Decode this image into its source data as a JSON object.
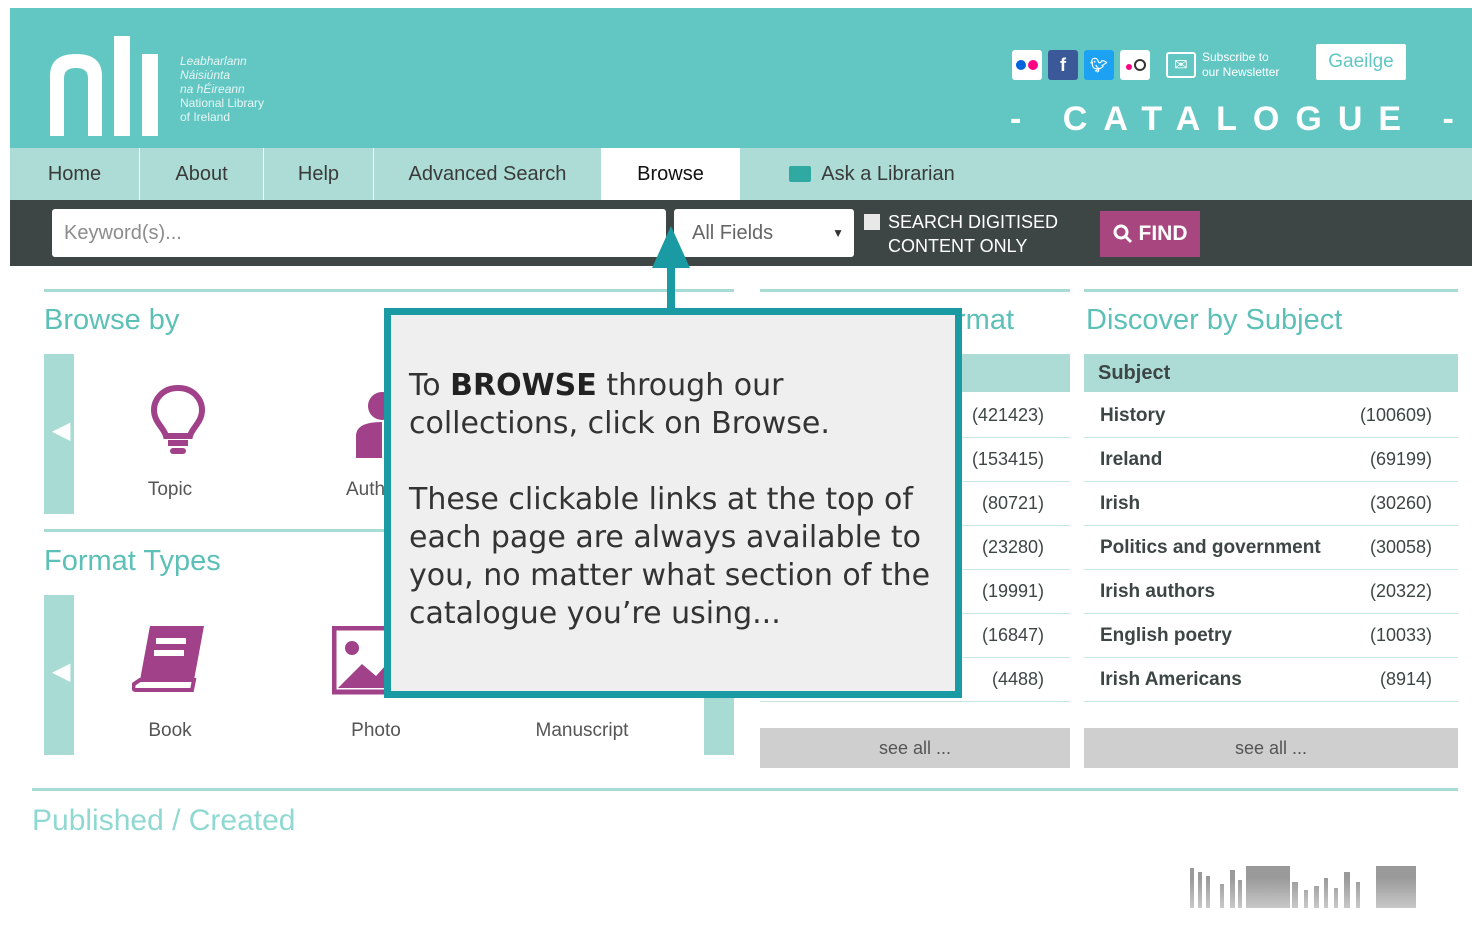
{
  "header": {
    "logo_lines_irish": [
      "Leabharlann",
      "Náisiúnta",
      "na hÉireann"
    ],
    "logo_lines_english": [
      "National Library",
      "of Ireland"
    ],
    "newsletter_line1": "Subscribe to",
    "newsletter_line2": "our Newsletter",
    "gaeilge_label": "Gaeilge",
    "catalogue_title": "- CATALOGUE -"
  },
  "nav": {
    "items": [
      {
        "label": "Home"
      },
      {
        "label": "About"
      },
      {
        "label": "Help"
      },
      {
        "label": "Advanced Search"
      },
      {
        "label": "Browse"
      },
      {
        "label": "Ask a Librarian"
      }
    ],
    "active": "Browse"
  },
  "search": {
    "keyword_placeholder": "Keyword(s)...",
    "field_selected": "All Fields",
    "digitised_line1": "SEARCH DIGITISED",
    "digitised_line2": "CONTENT ONLY",
    "find_label": "FIND"
  },
  "browse_by": {
    "title": "Browse by",
    "tiles": [
      {
        "label": "Topic"
      },
      {
        "label": "Auth"
      }
    ]
  },
  "format_types": {
    "title": "Format Types",
    "tiles": [
      {
        "label": "Book"
      },
      {
        "label": "Photo"
      },
      {
        "label": "Manuscript"
      }
    ]
  },
  "format_panel": {
    "title_partial": "rmat",
    "counts": [
      "(421423)",
      "(153415)",
      "(80721)",
      "(23280)",
      "(19991)",
      "(16847)",
      "(4488)"
    ],
    "see_all": "see all ..."
  },
  "discover": {
    "title": "Discover by Subject",
    "header": "Subject",
    "rows": [
      {
        "name": "History",
        "count": "(100609)"
      },
      {
        "name": "Ireland",
        "count": "(69199)"
      },
      {
        "name": "Irish",
        "count": "(30260)"
      },
      {
        "name": "Politics and government",
        "count": "(30058)"
      },
      {
        "name": "Irish authors",
        "count": "(20322)"
      },
      {
        "name": "English poetry",
        "count": "(10033)"
      },
      {
        "name": "Irish Americans",
        "count": "(8914)"
      }
    ],
    "see_all": "see all ..."
  },
  "published": {
    "title": "Published / Created"
  },
  "callout": {
    "p1_pre": "To ",
    "p1_bold": "BROWSE",
    "p1_post": " through our collections, click on Browse.",
    "p2": "These clickable links at the top of each page are always available to you, no matter what section of the catalogue you’re using..."
  },
  "colors": {
    "teal": "#62c7c3",
    "nav_bg": "#acdcd5",
    "search_bg": "#3d4645",
    "find_purple": "#a8467f",
    "callout_border": "#1a9aa3"
  }
}
